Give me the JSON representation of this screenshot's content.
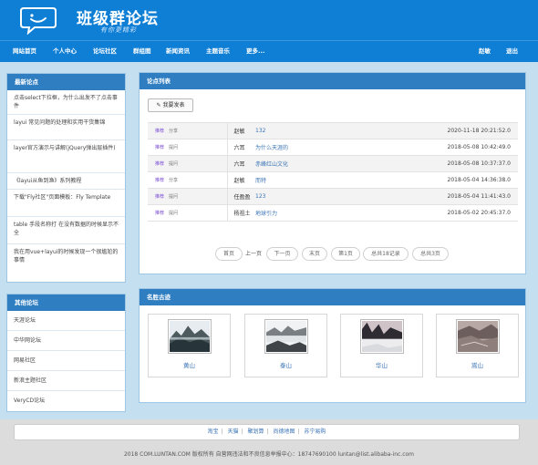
{
  "site": {
    "title": "班级群论坛",
    "slogan": "有你更精彩"
  },
  "nav": {
    "items": [
      "网站首页",
      "个人中心",
      "论坛社区",
      "群组图",
      "新闻资讯",
      "主题音乐",
      "更多..."
    ],
    "user": "赵敏",
    "logout": "退出"
  },
  "sidebar": {
    "latest": {
      "title": "最新论点",
      "items": [
        "点击select下拉框，为什么出发不了点击事件",
        "layui 常见问题的处理和实用干货集锦",
        "layer官方演示与讲解(jQuery弹出层插件)",
        "《layui从鱼到渔》系列教程",
        "下载\"Fly社区\"页面模板：Fly Template",
        "table 手段名称打 在没有数据的时候显示不全",
        "我在用vue+layui的时候发现一个很尴尬的事情"
      ]
    },
    "other": {
      "title": "其他论坛",
      "items": [
        "天涯论坛",
        "中华网论坛",
        "网易社区",
        "新浪主题社区",
        "VeryCD论坛"
      ]
    }
  },
  "topics": {
    "title": "论点列表",
    "post_label": "我要发表",
    "rows": [
      {
        "tag1": "推荐",
        "tag2": "分享",
        "author": "赵敏",
        "title": "132",
        "time": "2020-11-18 20:21:52.0"
      },
      {
        "tag1": "推荐",
        "tag2": "提问",
        "author": "六耳",
        "title": "为什么天涯的",
        "time": "2018-05-08 10:42:49.0"
      },
      {
        "tag1": "推荐",
        "tag2": "提问",
        "author": "六耳",
        "title": "赤峰红山文化",
        "time": "2018-05-08 10:37:37.0"
      },
      {
        "tag1": "推荐",
        "tag2": "分享",
        "author": "赵敏",
        "title": "而特",
        "time": "2018-05-04 14:36:38.0"
      },
      {
        "tag1": "推荐",
        "tag2": "提问",
        "author": "任盈盈",
        "title": "123",
        "time": "2018-05-04 11:41:43.0"
      },
      {
        "tag1": "推荐",
        "tag2": "提问",
        "author": "杨祖土",
        "title": "地球引力",
        "time": "2018-05-02 20:45:37.0"
      }
    ],
    "pager": {
      "first": "首页",
      "prev": "上一页",
      "next": "下一页",
      "last": "末页",
      "page": "第1页",
      "total_records": "总共18记录",
      "total_pages": "总共3页"
    }
  },
  "scenic": {
    "title": "名胜古迹",
    "items": [
      "黄山",
      "泰山",
      "华山",
      "嵩山"
    ]
  },
  "footer": {
    "links": [
      "淘宝",
      "天猫",
      "聚划算",
      "尚德地图",
      "苏宁易购"
    ],
    "copyright": "2018 COM.LUNTAN.COM 版权所有 自营网违法和不良信息举报中心：18747690100 luntan@list.alibaba-inc.com"
  },
  "colors": {
    "brand": "#0f7fd6",
    "panel_header": "#2f7ec1",
    "content_bg": "#c3dff0",
    "link": "#3a73b6"
  }
}
